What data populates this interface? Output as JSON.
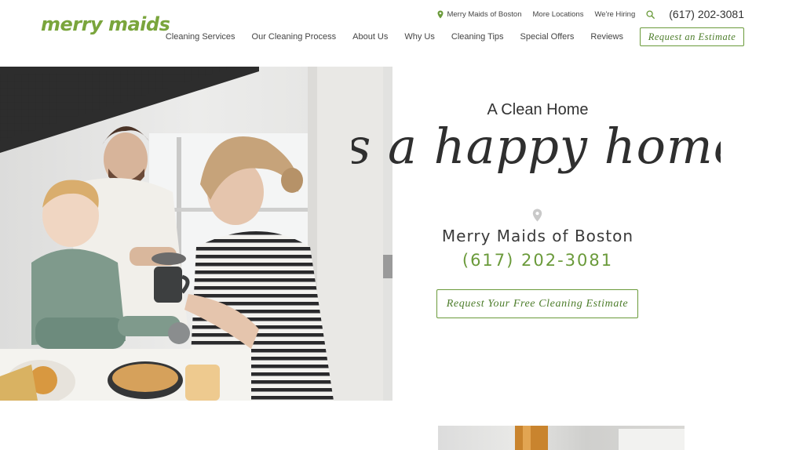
{
  "brand": {
    "logo_text": "merry maids",
    "accent": "#6a9a3a",
    "logo_color": "#7aa53c"
  },
  "utility": {
    "location_icon": "map-pin-icon",
    "location": "Merry Maids of Boston",
    "more_locations": "More Locations",
    "hiring": "We're Hiring",
    "search_icon": "search-icon",
    "phone": "(617) 202-3081"
  },
  "nav": {
    "items": [
      "Cleaning Services",
      "Our Cleaning Process",
      "About Us",
      "Why Us",
      "Cleaning Tips",
      "Special Offers",
      "Reviews"
    ],
    "cta": "Request an Estimate"
  },
  "hero": {
    "pre_title": "A Clean Home",
    "script_title": "is a happy home",
    "pin_icon": "map-pin-icon",
    "location_name": "Merry Maids of Boston",
    "phone": "(617) 202-3081",
    "cta": "Request Your Free Cleaning Estimate"
  }
}
